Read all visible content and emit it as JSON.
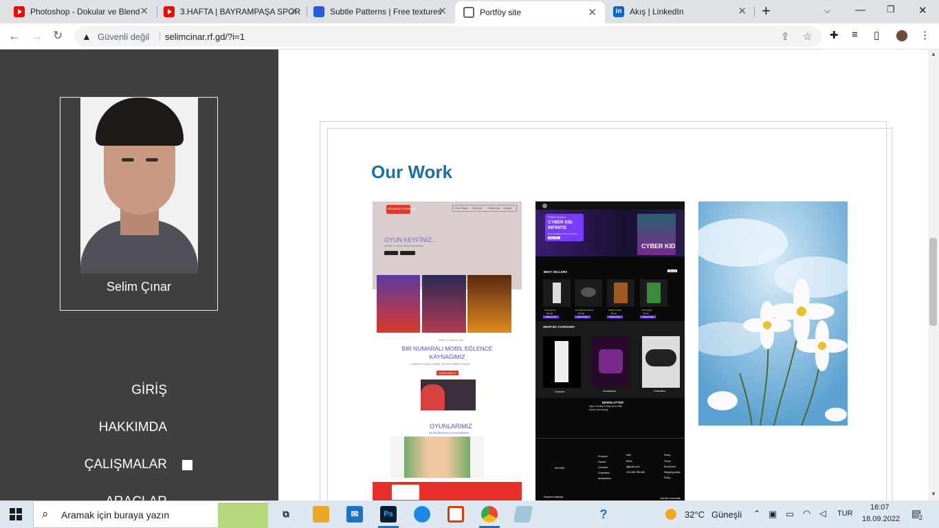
{
  "browser": {
    "tabs": [
      {
        "title": "Photoshop - Dokular ve Blend",
        "icon": "youtube-icon"
      },
      {
        "title": "3.HAFTA | BAYRAMPAŞA SPOR",
        "icon": "youtube-icon"
      },
      {
        "title": "Subtle Patterns | Free textures",
        "icon": "subtle-patterns-icon"
      },
      {
        "title": "Portföy site",
        "icon": "globe-icon",
        "active": true
      },
      {
        "title": "Akış | LinkedIn",
        "icon": "linkedin-icon"
      }
    ],
    "close_glyph": "✕",
    "new_tab_glyph": "+",
    "security_label": "Güvenli değil",
    "url": "selimcinar.rf.gd/?i=1"
  },
  "sidebar": {
    "name": "Selim Çınar",
    "menu": [
      {
        "label": "GİRİŞ"
      },
      {
        "label": "HAKKIMDA"
      },
      {
        "label": "ÇALIŞMALAR",
        "active": true
      },
      {
        "label": "ARAÇLAR"
      }
    ]
  },
  "main": {
    "section_title": "Our Work",
    "works": [
      {
        "name": "mobile-game-site",
        "texts": {
          "logo": "EĞLENCE OYUNLARI",
          "nav": [
            "Ana Sayfa",
            "Oyunlar",
            "Hakkında",
            "İletişim"
          ],
          "hero": "OYUN KEYFİNİZ...",
          "hero_sub": "MOBİL OYUNLARDA NUMARA",
          "tagline": "TÜRK OYUNCULAR",
          "headline": "BİR NUMARALI MOBİL EĞLENCE KAYNAĞIMIZ",
          "lorem": "LOREM IPSUM LOREM IPSUM LOREM IPSUM",
          "button": "DAHA FAZLA",
          "games_title": "OYUNLARIMIZ",
          "games_sub": "EN BEĞENİLEN OYUNLARIMIZ"
        }
      },
      {
        "name": "cyber-kid-store",
        "texts": {
          "hero_small": "Power up your",
          "hero_title": "CYBER KİD INFINITE",
          "hero_sub": "Now available on PC & Console",
          "hero_btn": "Shop Now",
          "hero_badge": "CYBER KID",
          "best_sellers": "BEST SELLERS",
          "view_all": "View all",
          "products": [
            {
              "name": "Cool Gen 3x",
              "price": "$49.99"
            },
            {
              "name": "GT Wireless Mouse",
              "price": "$14.99"
            },
            {
              "name": "Infinite Loader",
              "price": "$6.99"
            },
            {
              "name": "Cinemagain",
              "price": "$9.99"
            }
          ],
          "add_to_cart": "Add to Cart",
          "shop_by_category": "SHOP BY CATEGORY",
          "categories": [
            "Consoles",
            "Accessories",
            "Controllers"
          ],
          "newsletter_title": "NEWSLATTER",
          "newsletter_text": "Sign in today to stay up to date",
          "newsletter_text2": "brand new boring",
          "footer_brand": "ARCADE",
          "footer_links_1": [
            "Products",
            "Games",
            "Consoles",
            "Controllers",
            "Accessories"
          ],
          "footer_links_2": [
            "Mail",
            "Menu",
            "@gmail.com",
            "123-456-789-456"
          ],
          "footer_links_3": [
            "Policy",
            "Terms",
            "Enrollment",
            "Shipping policy",
            "Policy"
          ],
          "footer_left": "Payment methods",
          "footer_right": "Join the community"
        }
      },
      {
        "name": "flowers-photo"
      }
    ]
  },
  "taskbar": {
    "search_placeholder": "Aramak için buraya yazın",
    "photoshop_label": "Ps",
    "weather_temp": "32°C",
    "weather_desc": "Güneşli",
    "language": "TUR",
    "time": "16:07",
    "date": "18.09.2022",
    "notification_count": "2"
  },
  "colors": {
    "sidebar_bg": "#404040",
    "title_blue": "#1d6fa5",
    "cyber_purple": "#7a3cff",
    "game_red": "#e8302a"
  }
}
